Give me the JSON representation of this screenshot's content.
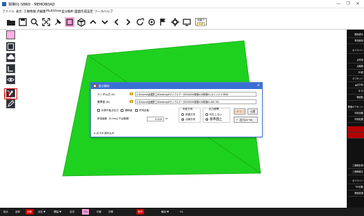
{
  "window": {
    "title": "現場01-SBND - MEMOBOAD",
    "min_glyph": "—",
    "max_glyph": "❐",
    "close_glyph": "✕"
  },
  "menu": [
    "ファイル",
    "表示",
    "工事情報",
    "点編集",
    "MultiView",
    "差分解析",
    "図面作成",
    "設定",
    "ツール",
    "ヘルプ"
  ],
  "toolbar": {
    "icons": [
      "open-folder-icon",
      "save-icon",
      "zoom-icon",
      "fit-view-icon",
      "pin-icon",
      "eraser-icon",
      "cube-icon",
      "arrow-up-icon",
      "arrow-down-icon",
      "arrow-left-icon",
      "arrow-right-icon",
      "rotate-icon",
      "target-icon",
      "flag-icon",
      "settings-icon",
      "monitor-icon"
    ],
    "mode_label": "段面下",
    "mode_value": "1.0"
  },
  "annotation": {
    "marker": "①"
  },
  "dialog": {
    "title": "差分解析",
    "close_glyph": "×",
    "random_label": "ランダム点 (A)",
    "random_path": "C:¥Users¥武蔵野工¥Desktop¥サンプルデータ¥2005¥現場01¥現場01-オリジナル.RND",
    "base_label": "基準面 (B)",
    "base_path": "C:¥Users¥武蔵野工¥Desktop¥サンプルデータ¥2005¥現場01¥現場01-BD.TIN",
    "checks": [
      "計算不能点出力",
      "傾斜値",
      "符号反転"
    ],
    "tolerance_label": "許容誤差（0.0m以下は無視）",
    "tolerance_value": "0.000",
    "tolerance_unit": "m",
    "judge_group": "判定方向",
    "judge_options": [
      "鉛直方向",
      "法線方向"
    ],
    "output_group": "出力座標",
    "output_options": [
      "何もしない",
      "基準面上"
    ],
    "btn_calc": "自動設定",
    "btn_exec": "元実",
    "btn_output": "出力(A−B)",
    "status": "A 点 6,8 読み込み"
  },
  "rightpanel": [
    {
      "label": "断面表示",
      "red": false
    },
    {
      "label": "有効無効",
      "red": false
    },
    {
      "label": "ポリライン",
      "red": false
    },
    {
      "label": "点作成",
      "red": false
    },
    {
      "label": "点編集",
      "red": false
    },
    {
      "label": "3D回",
      "red": false
    },
    {
      "label": "オフセット",
      "red": false
    },
    {
      "label": "▲点分系",
      "red": false
    },
    {
      "label": "平 行",
      "red": false
    },
    {
      "label": "軸回転",
      "red": false
    },
    {
      "label": "断面オフセット",
      "red": false
    },
    {
      "label": "外周自動",
      "red": false
    },
    {
      "label": "外周処理",
      "red": false
    },
    {
      "label": "",
      "red": true
    },
    {
      "label": "",
      "red": true
    },
    {
      "label": "三角網計算",
      "red": false
    },
    {
      "label": "三角網修正",
      "red": false
    },
    {
      "label": "ポリライン",
      "red": false
    },
    {
      "label": "TIN切取",
      "red": false
    },
    {
      "label": "断面変換",
      "red": false
    }
  ],
  "bottombar": [
    {
      "label": "拡大",
      "style": "plain"
    },
    {
      "label": "全体",
      "style": "plain"
    },
    {
      "label": "全範",
      "style": "red"
    },
    {
      "label": "点名 ▼",
      "style": "plain"
    },
    {
      "label": "標高 ▼",
      "style": "plain"
    },
    {
      "label": "点次",
      "style": "plain"
    },
    {
      "label": "TIN",
      "style": "pink"
    },
    {
      "label": "平面",
      "style": "plain"
    },
    {
      "label": "方眼",
      "style": "plain"
    },
    {
      "label": "配列",
      "style": "red"
    },
    {
      "label": "軸目 ▼",
      "style": "plain"
    },
    {
      "label": "GL",
      "style": "plain"
    }
  ],
  "colors": {
    "surface_green": "#1fd11f",
    "surface_edge": "#14a814",
    "dialog_title": "#3b6fd4",
    "highlight_red": "#e00000"
  }
}
